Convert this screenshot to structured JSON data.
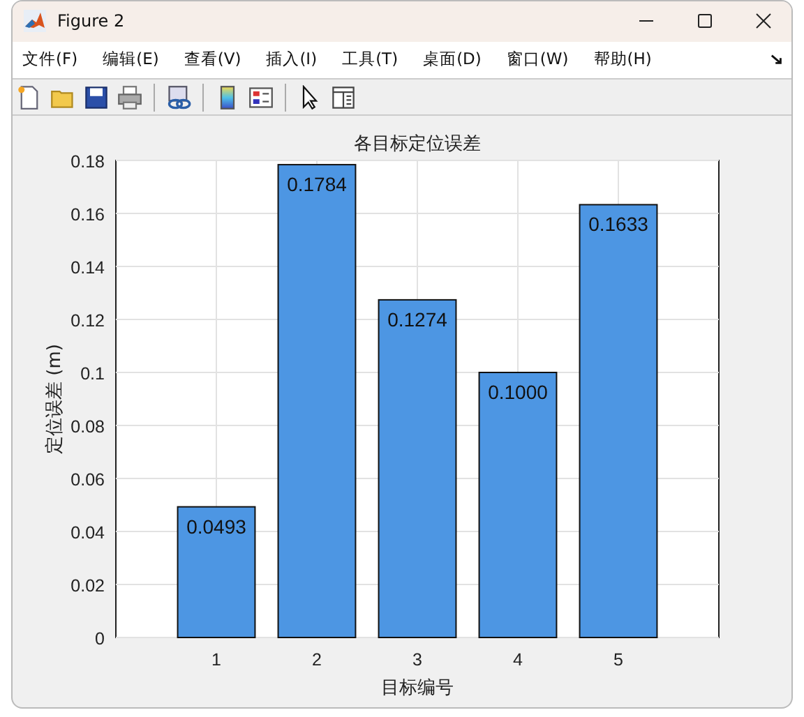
{
  "window": {
    "title": "Figure 2"
  },
  "menu": [
    {
      "label": "文件(F)"
    },
    {
      "label": "编辑(E)"
    },
    {
      "label": "查看(V)"
    },
    {
      "label": "插入(I)"
    },
    {
      "label": "工具(T)"
    },
    {
      "label": "桌面(D)"
    },
    {
      "label": "窗口(W)"
    },
    {
      "label": "帮助(H)"
    }
  ],
  "chart_data": {
    "type": "bar",
    "title": "各目标定位误差",
    "xlabel": "目标编号",
    "ylabel": "定位误差 (m)",
    "categories": [
      "1",
      "2",
      "3",
      "4",
      "5"
    ],
    "series": [
      {
        "color": "#4d96e3",
        "values": [
          0.0493,
          0.1784,
          0.1274,
          0.1,
          0.1633
        ]
      }
    ],
    "ylim": [
      0,
      0.18
    ],
    "yticks": [
      0,
      0.02,
      0.04,
      0.06,
      0.08,
      0.1,
      0.12,
      0.14,
      0.16,
      0.18
    ],
    "grid": true,
    "value_labels": [
      "0.0493",
      "0.1784",
      "0.1274",
      "0.1000",
      "0.1633"
    ]
  }
}
